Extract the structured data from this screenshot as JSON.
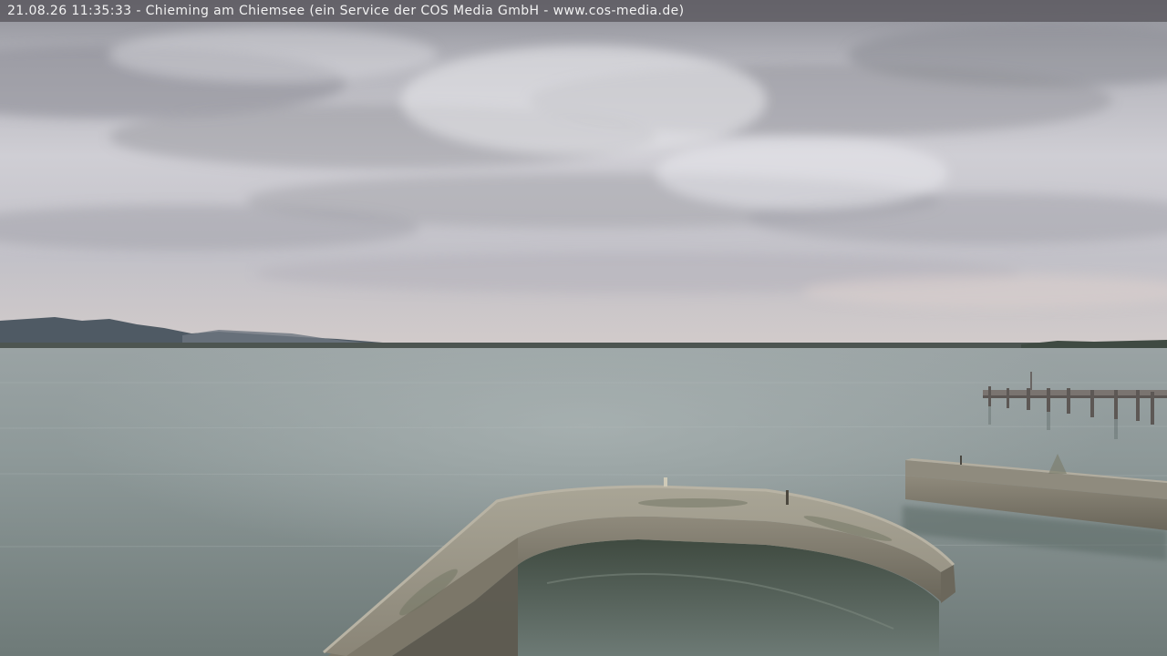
{
  "overlay": {
    "caption": "21.08.26 11:35:33 - Chieming am Chiemsee (ein Service der COS Media GmbH - www.cos-media.de)"
  },
  "colors": {
    "sky_top": "#8e8f96",
    "sky_mid": "#d4d3d8",
    "sky_horizon": "#c9c3c3",
    "mountains": "#4c5761",
    "lake": "#8f9a99",
    "lake_dark": "#6c7877",
    "stone_wall": "#9d988b",
    "stone_dark": "#5a5649",
    "pier": "#6f6a66",
    "caption_bar": "#58565c",
    "caption_text": "#f2f2f2"
  },
  "scene": {
    "subject": "lakeside webcam view",
    "elements": [
      "cloudy-sky",
      "mountain-range",
      "lake-water",
      "curved-harbor-wall",
      "breakwater",
      "wooden-pier"
    ]
  }
}
